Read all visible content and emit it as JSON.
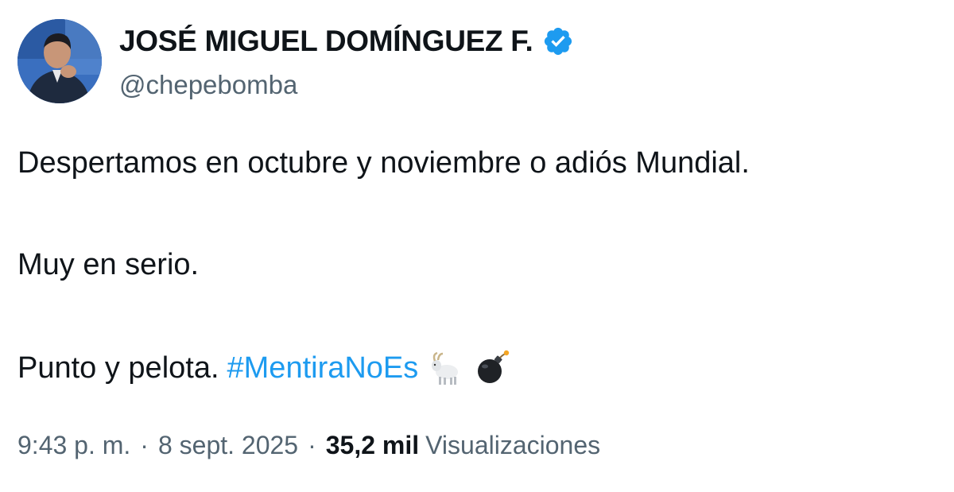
{
  "author": {
    "display_name": "JOSÉ MIGUEL DOMÍNGUEZ F.",
    "handle": "@chepebomba",
    "verified_icon": "verified-badge-icon",
    "avatar_icon": "profile-photo"
  },
  "tweet": {
    "line1": "Despertamos en octubre y noviembre o adiós Mundial.",
    "line2": "Muy en serio.",
    "line3_text": "Punto y pelota.",
    "hashtag": "#MentiraNoEs",
    "emojis": [
      "goat-emoji",
      "bomb-emoji"
    ]
  },
  "meta": {
    "time": "9:43 p. m.",
    "separator": "·",
    "date": "8 sept. 2025",
    "views_count": "35,2 mil",
    "views_label": "Visualizaciones"
  },
  "colors": {
    "text": "#0f1419",
    "secondary": "#536471",
    "link": "#1d9bf0",
    "verified": "#1d9bf0"
  }
}
